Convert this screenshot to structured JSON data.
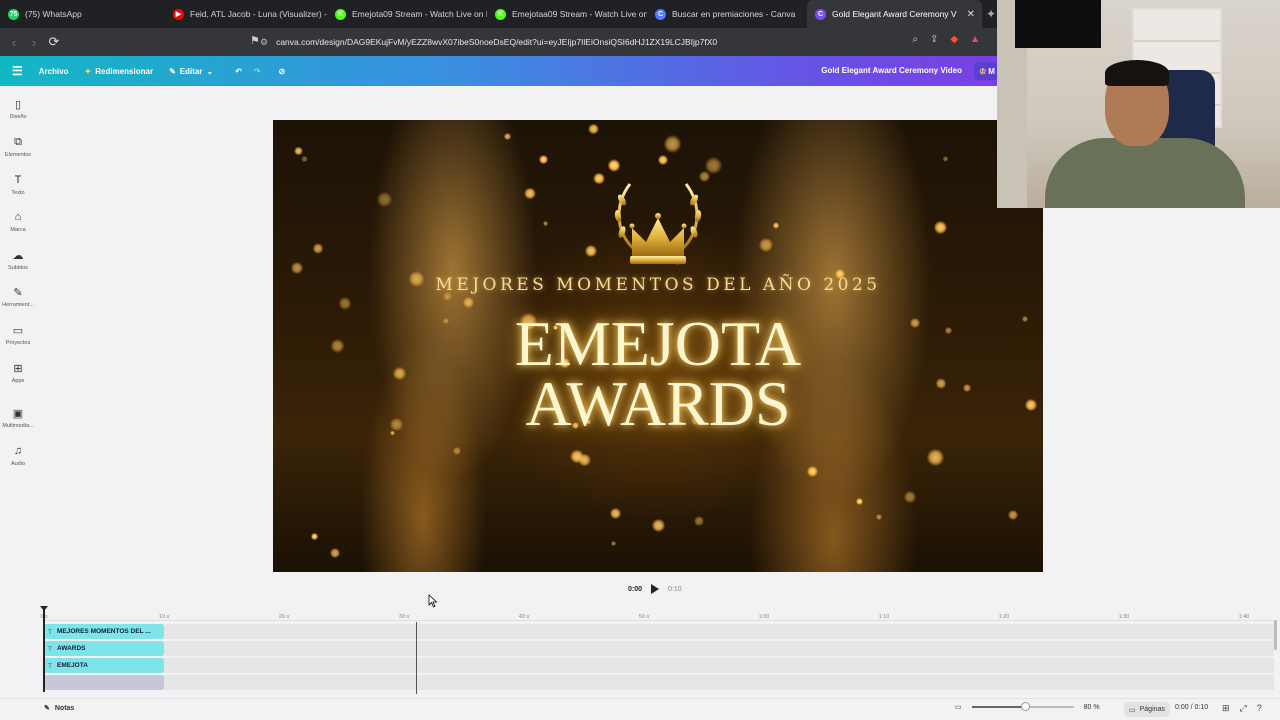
{
  "browser": {
    "tabs": [
      {
        "label": "(75) WhatsApp",
        "icon": "whatsapp-icon",
        "color": "#25d366",
        "glyph": "75"
      },
      {
        "label": "Feid, ATL Jacob - Luna (Visualizer) - Y",
        "icon": "youtube-icon",
        "color": "#ff0000",
        "glyph": "▶"
      },
      {
        "label": "Emejota09 Stream - Watch Live on K",
        "icon": "kick-icon",
        "color": "#53fc18",
        "glyph": "K"
      },
      {
        "label": "Emejotaa09 Stream - Watch Live on",
        "icon": "kick-icon",
        "color": "#53fc18",
        "glyph": "K"
      },
      {
        "label": "Buscar en premiaciones - Canva",
        "icon": "canva-icon",
        "color": "#4f7cff",
        "glyph": "C"
      },
      {
        "label": "Gold Elegant Award Ceremony V",
        "icon": "canva-icon",
        "color": "#7a4ef0",
        "glyph": "C",
        "active": true
      }
    ],
    "url": "canva.com/design/DAG9EKujFvM/yEZZ8wvX07ibeS0noeDsEQ/edit?ui=eyJEIjp7IlEiOnsiQSI6dHJ1ZX19LCJBIjp7fX0"
  },
  "canva": {
    "header": {
      "menu_label": "Archive",
      "file_label": "Archivo",
      "resize_label": "Redimensionar",
      "edit_label": "Editar",
      "doc_title": "Gold Elegant Award Ceremony Video",
      "share_chip": "M"
    },
    "sidebar": [
      {
        "label": "Diseño",
        "icon": "design-icon",
        "glyph": "▯"
      },
      {
        "label": "Elementos",
        "icon": "elements-icon",
        "glyph": "⧉"
      },
      {
        "label": "Texto",
        "icon": "text-icon",
        "glyph": "T"
      },
      {
        "label": "Marca",
        "icon": "brand-icon",
        "glyph": "⌂"
      },
      {
        "label": "Subidos",
        "icon": "uploads-icon",
        "glyph": "☁"
      },
      {
        "label": "Herramient...",
        "icon": "tools-icon",
        "glyph": "✎"
      },
      {
        "label": "Proyectos",
        "icon": "projects-icon",
        "glyph": "▭"
      },
      {
        "label": "Apps",
        "icon": "apps-icon",
        "glyph": "⊞"
      },
      {
        "label": "Multimedia...",
        "icon": "multimedia-icon",
        "glyph": "▣"
      },
      {
        "label": "Audio",
        "icon": "audio-icon",
        "glyph": "♫"
      }
    ],
    "design": {
      "subtitle": "MEJORES MOMENTOS DEL AÑO 2025",
      "title_line1": "EMEJOTA",
      "title_line2": "AWARDS"
    },
    "playback": {
      "current": "0:00",
      "duration": "0:10"
    },
    "timeline": {
      "ticks": [
        "0 s",
        "10 s",
        "20 s",
        "30 s",
        "40 s",
        "50 s",
        "1:00",
        "1:10",
        "1:20",
        "1:30",
        "1:40"
      ],
      "clips": [
        {
          "label": "MEJORES MOMENTOS DEL ...",
          "kind": "text"
        },
        {
          "label": "AWARDS",
          "kind": "text"
        },
        {
          "label": "EMEJOTA",
          "kind": "text"
        },
        {
          "label": "",
          "kind": "media"
        }
      ]
    },
    "footer": {
      "notes_label": "Notas",
      "zoom": "80 %",
      "zoom_fraction": 0.52,
      "pages_label": "Páginas",
      "time_display": "0:00 / 0:10"
    }
  }
}
